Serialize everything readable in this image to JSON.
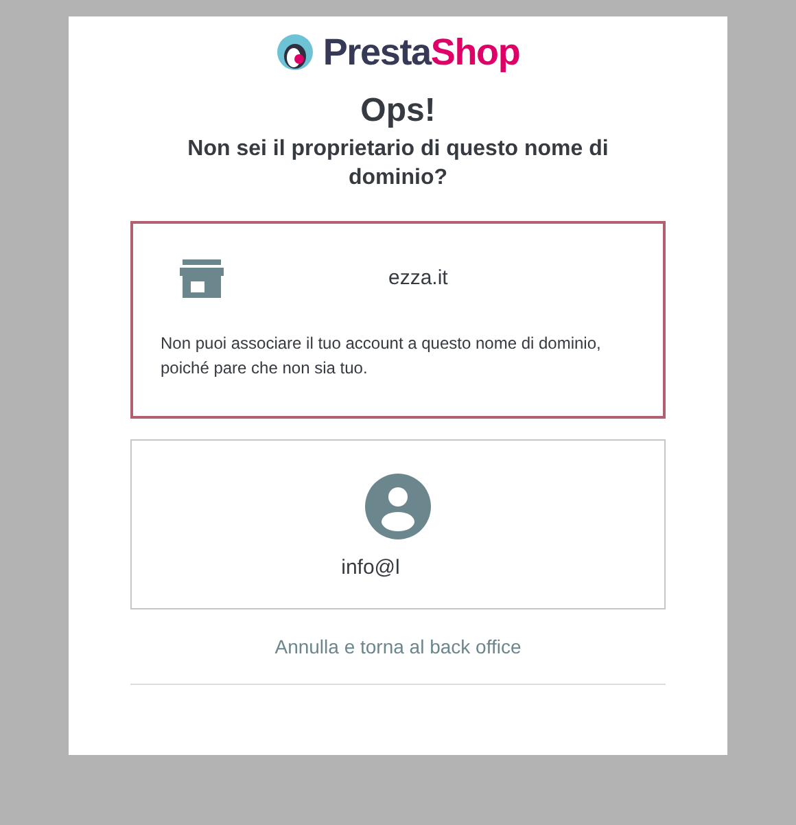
{
  "logo": {
    "text_dark": "Presta",
    "text_accent": "Shop"
  },
  "heading": "Ops!",
  "subheading": "Non sei il proprietario di questo nome di dominio?",
  "shop_card": {
    "domain": "ezza.it",
    "message": "Non puoi associare il tuo account a questo nome di dominio, poiché pare che non sia tuo.",
    "selected": true
  },
  "account_card": {
    "email": "info@l",
    "selected": false
  },
  "cancel_link": "Annulla e torna al back office"
}
